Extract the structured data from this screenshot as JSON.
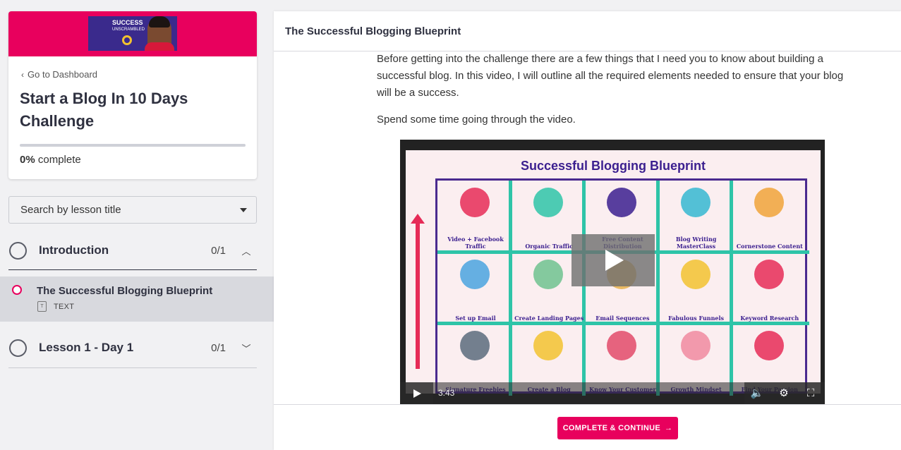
{
  "sidebar": {
    "banner": {
      "thumb_line1": "SUCCESS",
      "thumb_line2": "UNSCRAMBLED"
    },
    "dashboard_link": "Go to Dashboard",
    "course_title": "Start a Blog In 10 Days Challenge",
    "progress": {
      "percent": 0,
      "percent_label": "0%",
      "suffix": "complete"
    },
    "search": {
      "placeholder": "Search by lesson title"
    },
    "chapters": [
      {
        "title": "Introduction",
        "count": "0/1",
        "expanded": true,
        "lessons": [
          {
            "title": "The Successful Blogging Blueprint",
            "type": "TEXT",
            "active": true
          }
        ]
      },
      {
        "title": "Lesson 1 - Day 1",
        "count": "0/1",
        "expanded": false
      }
    ]
  },
  "main": {
    "header_title": "The Successful Blogging Blueprint",
    "paragraphs": [
      "Before getting into the challenge there are a few things that I need you to know about building a successful blog.  In this video, I will outline all the required elements needed to ensure that your blog will be a success.",
      "Spend some time going through the video."
    ],
    "video": {
      "title": "Successful Blogging Blueprint",
      "time": "3:43",
      "cells": [
        "Video + Facebook Traffic",
        "Organic Traffic",
        "Free Content Distribution",
        "Blog Writing MasterClass",
        "Cornerstone Content",
        "Set up Email",
        "Create Landing Pages",
        "Email Sequences",
        "Fabulous Funnels",
        "Keyword Research",
        "Signature Freebies",
        "Create a Blog",
        "Know Your Customer",
        "Growth Mindset",
        "Find Your Passion"
      ]
    },
    "complete_button": "COMPLETE & CONTINUE"
  },
  "colors": {
    "accent": "#e8005d",
    "teal": "#2ec4a8",
    "purple": "#3b1f8f"
  }
}
